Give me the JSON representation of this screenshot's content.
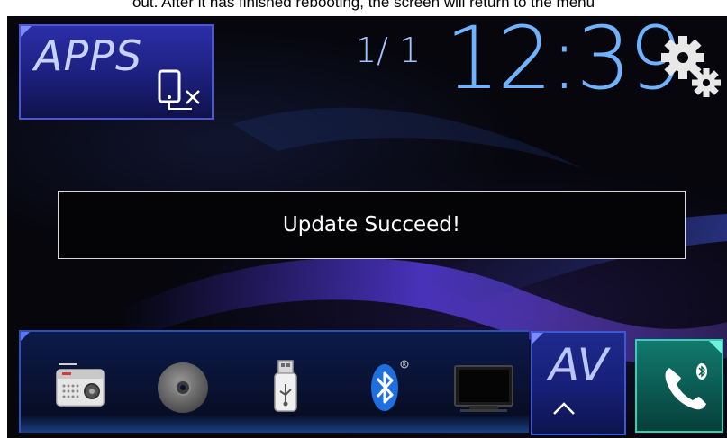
{
  "document": {
    "caption": "out. After it has finished rebooting, the screen will return to the menu"
  },
  "header": {
    "apps_label": "APPS",
    "date": "1/ 1",
    "time": "12:39"
  },
  "dialog": {
    "message": "Update Succeed!"
  },
  "source_bar": {
    "av_label": "AV",
    "sources": [
      {
        "icon": "radio-icon"
      },
      {
        "icon": "disc-icon"
      },
      {
        "icon": "usb-icon"
      },
      {
        "icon": "bluetooth-icon"
      },
      {
        "icon": "tv-icon"
      }
    ]
  },
  "colors": {
    "clock": "#6fb2ff",
    "apps_tile": "#2b2fa8",
    "av_tile": "#1e2a8c",
    "phone_tile": "#0b5a52",
    "dialog_border": "#d9d9d9"
  }
}
